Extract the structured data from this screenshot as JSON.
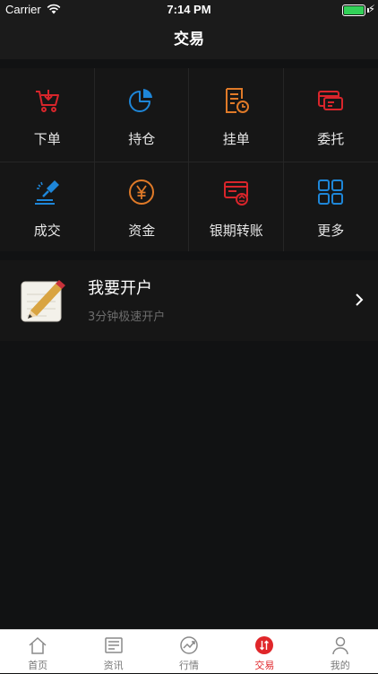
{
  "status_bar": {
    "carrier": "Carrier",
    "time": "7:14 PM",
    "battery_level": 1.0
  },
  "nav": {
    "title": "交易"
  },
  "grid": {
    "items": [
      {
        "label": "下单",
        "icon": "cart-download-icon",
        "color": "#d8252b"
      },
      {
        "label": "持仓",
        "icon": "pie-chart-icon",
        "color": "#1e86d8"
      },
      {
        "label": "挂单",
        "icon": "pending-order-icon",
        "color": "#e07a28"
      },
      {
        "label": "委托",
        "icon": "card-icon",
        "color": "#d8252b"
      },
      {
        "label": "成交",
        "icon": "gavel-icon",
        "color": "#1e86d8"
      },
      {
        "label": "资金",
        "icon": "yen-coin-icon",
        "color": "#e07a28"
      },
      {
        "label": "银期转账",
        "icon": "transfer-card-icon",
        "color": "#d8252b"
      },
      {
        "label": "更多",
        "icon": "more-grid-icon",
        "color": "#1e86d8"
      }
    ]
  },
  "open_account": {
    "title": "我要开户",
    "subtitle": "3分钟极速开户"
  },
  "tabs": [
    {
      "label": "首页",
      "icon": "home-icon"
    },
    {
      "label": "资讯",
      "icon": "news-icon"
    },
    {
      "label": "行情",
      "icon": "market-trend-icon"
    },
    {
      "label": "交易",
      "icon": "trade-icon",
      "active": true
    },
    {
      "label": "我的",
      "icon": "user-icon"
    }
  ],
  "colors": {
    "accent": "#e0262a",
    "background": "#111213",
    "panel": "#161616"
  }
}
